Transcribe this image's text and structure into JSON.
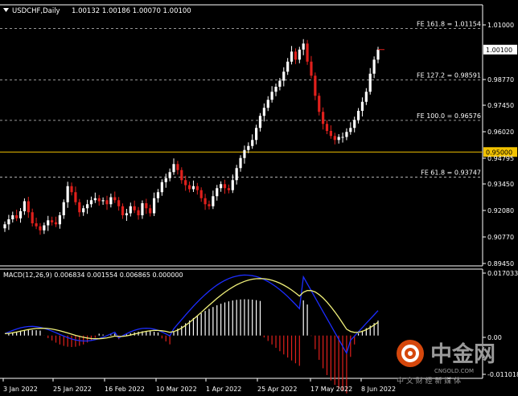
{
  "header": {
    "menu_icon": "triangle-down-icon",
    "symbol": "USDCHF,Daily",
    "ohlc": "1.00132 1.00186 1.00070 1.00100"
  },
  "macd_header": "MACD(12,26,9) 0.006834 0.001554 0.006865 0.000000",
  "fib_levels": [
    {
      "label": "FE 161.8 = 1.01154",
      "price": 1.01154
    },
    {
      "label": "FE 127.2 = 0.98591",
      "price": 0.98591
    },
    {
      "label": "FE 100.0 = 0.96576",
      "price": 0.96576
    },
    {
      "label": "FE 61.8 = 0.93747",
      "price": 0.93747
    }
  ],
  "horizontal_line": {
    "price": 0.95,
    "label": "0.95000",
    "color": "#f2c200"
  },
  "current_price": {
    "price": 1.001,
    "label": "1.00100"
  },
  "price_axis_ticks": [
    "1.01000",
    "0.98770",
    "0.97450",
    "0.96020",
    "0.94795",
    "0.93450",
    "0.92080",
    "0.90770",
    "0.89450"
  ],
  "macd_axis_ticks": [
    "0.017033",
    "0.00",
    "-0.011018"
  ],
  "date_axis_ticks": [
    "3 Jan 2022",
    "25 Jan 2022",
    "16 Feb 2022",
    "10 Mar 2022",
    "1 Apr 2022",
    "25 Apr 2022",
    "17 May 2022",
    "8 Jun 2022"
  ],
  "watermark": {
    "logo_text": "中金网",
    "sub_text": "中 文 财 经 新 媒 体",
    "url": "CNGOLD.COM"
  },
  "colors": {
    "background": "#000000",
    "bull_candle": "#ffffff",
    "bear_candle": "#e0201c",
    "grid": "#ffffff",
    "macd_line": "#1c2dff",
    "signal_line": "#f0f07a",
    "hline": "#f2c200"
  },
  "chart_data": {
    "type": "candlestick",
    "symbol": "USDCHF",
    "timeframe": "Daily",
    "ylim": [
      0.8945,
      1.0177
    ],
    "closes": [
      0.914,
      0.9165,
      0.9185,
      0.917,
      0.9205,
      0.9255,
      0.92,
      0.9145,
      0.913,
      0.911,
      0.9135,
      0.916,
      0.915,
      0.914,
      0.9185,
      0.925,
      0.933,
      0.93,
      0.925,
      0.92,
      0.922,
      0.924,
      0.926,
      0.927,
      0.9255,
      0.926,
      0.924,
      0.9275,
      0.926,
      0.923,
      0.9185,
      0.9195,
      0.923,
      0.921,
      0.9185,
      0.9245,
      0.922,
      0.9195,
      0.927,
      0.93,
      0.935,
      0.937,
      0.94,
      0.944,
      0.941,
      0.936,
      0.9335,
      0.9315,
      0.933,
      0.931,
      0.927,
      0.924,
      0.923,
      0.928,
      0.932,
      0.934,
      0.932,
      0.931,
      0.936,
      0.942,
      0.947,
      0.951,
      0.953,
      0.956,
      0.962,
      0.968,
      0.972,
      0.976,
      0.98,
      0.9825,
      0.9855,
      0.99,
      0.995,
      1.0,
      0.996,
      1.001,
      1.004,
      0.995,
      0.988,
      0.978,
      0.97,
      0.964,
      0.9605,
      0.958,
      0.956,
      0.9575,
      0.9575,
      0.96,
      0.962,
      0.966,
      0.9705,
      0.975,
      0.98,
      0.989,
      0.996,
      1.001
    ],
    "macd_histogram_range": [
      -0.011018,
      0.017033
    ]
  }
}
